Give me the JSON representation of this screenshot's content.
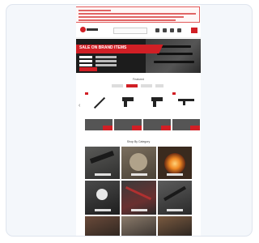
{
  "hero": {
    "headline": "SALE ON BRAND ITEMS"
  },
  "sections": {
    "featured_heading": "Featured",
    "categories_heading": "Shop By Category"
  },
  "colors": {
    "brand_red": "#d11f25",
    "dark": "#1c1c1c",
    "alert_border": "#e25a5a"
  },
  "icons": {
    "prev": "chevron-left-icon",
    "next": "chevron-right-icon",
    "cart": "cart-icon"
  },
  "nav": {
    "prev_glyph": "‹",
    "next_glyph": "›"
  }
}
